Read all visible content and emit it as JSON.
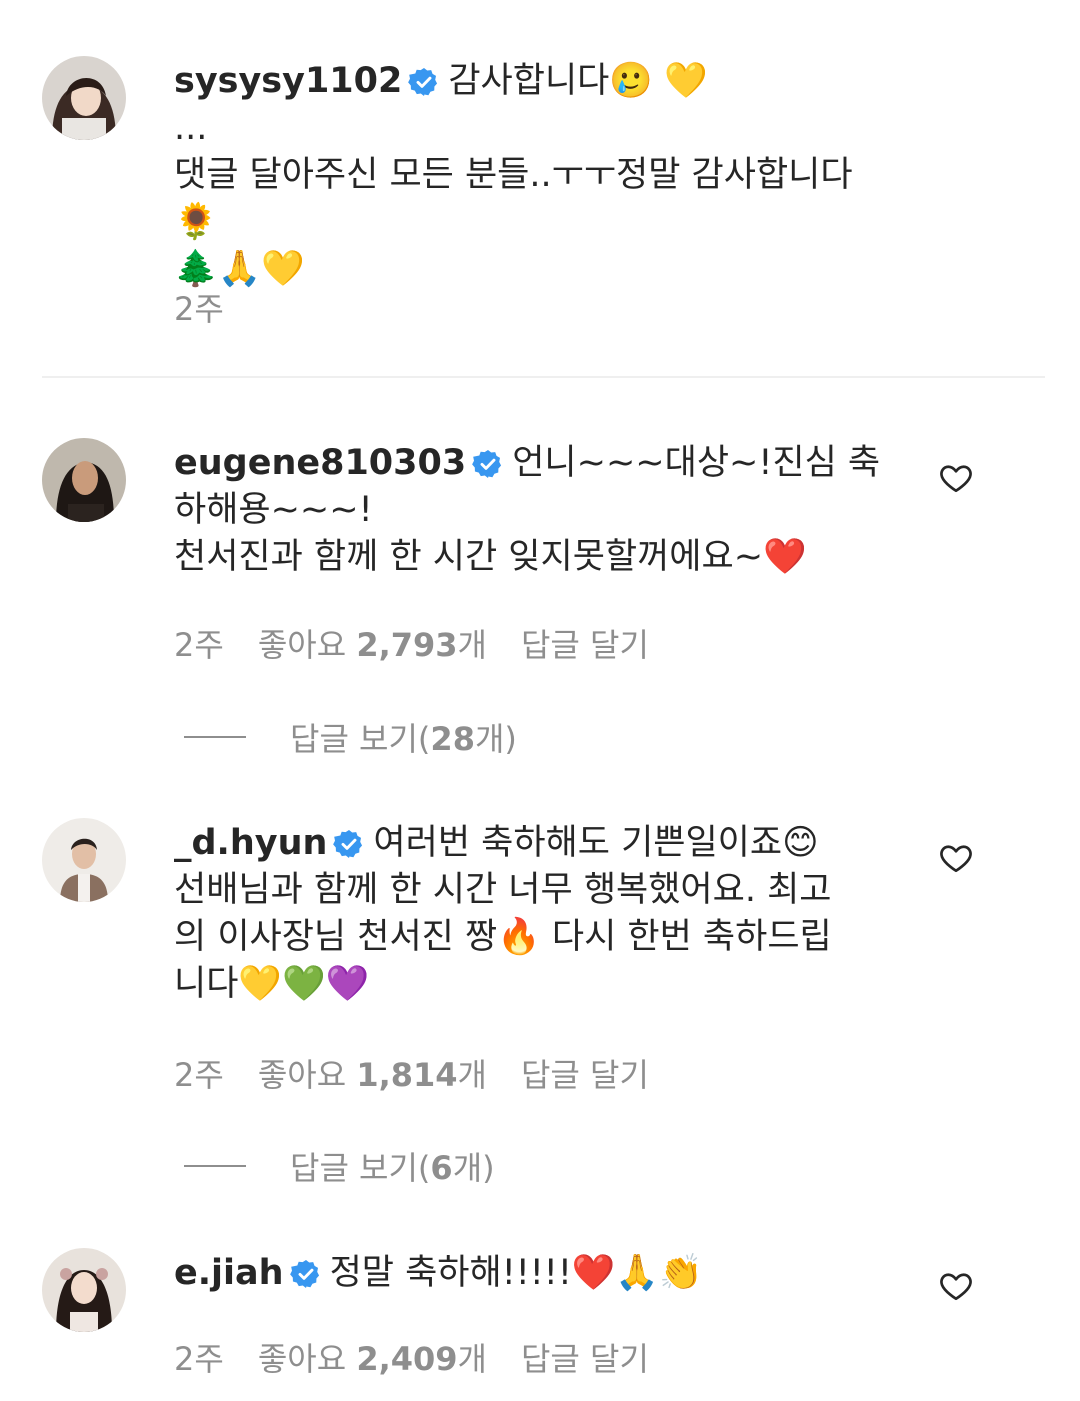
{
  "caption": {
    "username": "sysysy1102",
    "lines": [
      "감사합니다🥲 💛",
      "...",
      "댓글 달아주신 모든 분들..ㅜㅜ정말 감사합니다🌻",
      "🌲🙏💛"
    ],
    "time": "2주"
  },
  "comments": [
    {
      "username": "eugene810303",
      "lines": [
        "언니~~~대상~!진심 축",
        "하해용~~~!",
        "천서진과 함께 한 시간 잊지못할꺼에요~❤️"
      ],
      "time": "2주",
      "likes_label": "좋아요",
      "likes_count": "2,793",
      "likes_suffix": "개",
      "reply_label": "답글 달기",
      "view_replies_label": "답글 보기(",
      "view_replies_count": "28",
      "view_replies_suffix": "개)"
    },
    {
      "username": "_d.hyun",
      "lines": [
        "여러번 축하해도 기쁜일이죠😊",
        "선배님과 함께 한 시간 너무 행복했어요. 최고",
        "의 이사장님 천서진 짱🔥 다시 한번 축하드립",
        "니다💛💚💜"
      ],
      "time": "2주",
      "likes_label": "좋아요",
      "likes_count": "1,814",
      "likes_suffix": "개",
      "reply_label": "답글 달기",
      "view_replies_label": "답글 보기(",
      "view_replies_count": "6",
      "view_replies_suffix": "개)"
    },
    {
      "username": "e.jiah",
      "lines": [
        "정말 축하해!!!!!❤️🙏👏"
      ],
      "time": "2주",
      "likes_label": "좋아요",
      "likes_count": "2,409",
      "likes_suffix": "개",
      "reply_label": "답글 달기"
    }
  ],
  "colors": {
    "text": "#262626",
    "secondary": "#8e8e8e",
    "verified": "#3897f0",
    "divider": "#efefef"
  },
  "icons": {
    "verified": "verified-badge-icon",
    "like": "heart-outline-icon"
  }
}
